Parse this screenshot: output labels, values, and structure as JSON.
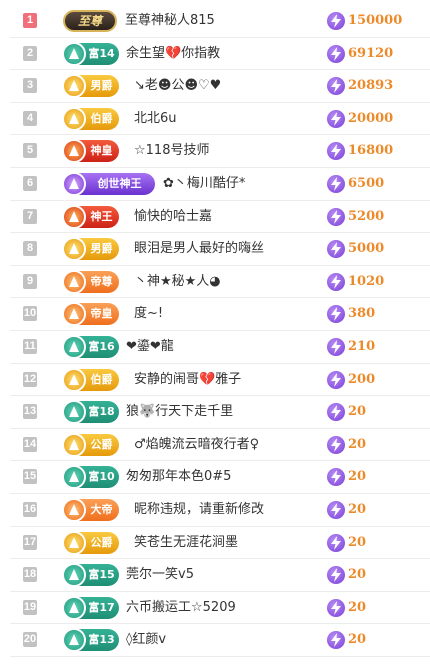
{
  "ranking": [
    {
      "rank": "1",
      "badge": "至尊",
      "name": "至尊神秘人815",
      "score": "150000"
    },
    {
      "rank": "2",
      "badge": "富14",
      "name": "余生望💔你指教",
      "score": "69120"
    },
    {
      "rank": "3",
      "badge": "男爵",
      "name": "↘老☻公☻♡♥",
      "score": "20893"
    },
    {
      "rank": "4",
      "badge": "伯爵",
      "name": "北北6u",
      "score": "20000"
    },
    {
      "rank": "5",
      "badge": "神皇",
      "name": "☆118号技师",
      "score": "16800"
    },
    {
      "rank": "6",
      "badge": "创世神王",
      "name": "✿丶梅川酷仔*",
      "score": "6500"
    },
    {
      "rank": "7",
      "badge": "神王",
      "name": "愉快的哈士嘉",
      "score": "5200"
    },
    {
      "rank": "8",
      "badge": "男爵",
      "name": "眼泪是男人最好的嗨丝",
      "score": "5000"
    },
    {
      "rank": "9",
      "badge": "帝尊",
      "name": "丶神★秘★人◕",
      "score": "1020"
    },
    {
      "rank": "10",
      "badge": "帝皇",
      "name": "度~!",
      "score": "380"
    },
    {
      "rank": "11",
      "badge": "富16",
      "name": "❤鎏❤龍",
      "score": "210"
    },
    {
      "rank": "12",
      "badge": "伯爵",
      "name": "安静的闹哥💔雅子",
      "score": "200"
    },
    {
      "rank": "13",
      "badge": "富18",
      "name": "狼🐺行天下走千里",
      "score": "20"
    },
    {
      "rank": "14",
      "badge": "公爵",
      "name": "♂焰魄流云暗夜行者♀",
      "score": "20"
    },
    {
      "rank": "15",
      "badge": "富10",
      "name": "匆匆那年本色0#5",
      "score": "20"
    },
    {
      "rank": "16",
      "badge": "大帝",
      "name": "昵称违规，请重新修改",
      "score": "20"
    },
    {
      "rank": "17",
      "badge": "公爵",
      "name": "笑苍生无涯花涧墨",
      "score": "20"
    },
    {
      "rank": "18",
      "badge": "富15",
      "name": "莞尔一笑v5",
      "score": "20"
    },
    {
      "rank": "19",
      "badge": "富17",
      "name": "六币搬运工☆5209",
      "score": "20"
    },
    {
      "rank": "20",
      "badge": "富13",
      "name": "◊红颜v",
      "score": "20"
    }
  ],
  "badge_styles": {
    "至尊": "supreme",
    "富14": "green",
    "富16": "green",
    "富18": "green",
    "富10": "green",
    "富15": "green",
    "富17": "green",
    "富13": "green",
    "男爵": "gold",
    "伯爵": "gold",
    "公爵": "gold",
    "神皇": "red",
    "神王": "red",
    "创世神王": "purple",
    "帝尊": "orange",
    "帝皇": "orange",
    "大帝": "orange"
  },
  "score_icon": "lightning-icon",
  "colors": {
    "rank_top": "#ef6f7b",
    "rank_default": "#c2c2c2",
    "score": "#ec8a2a"
  }
}
